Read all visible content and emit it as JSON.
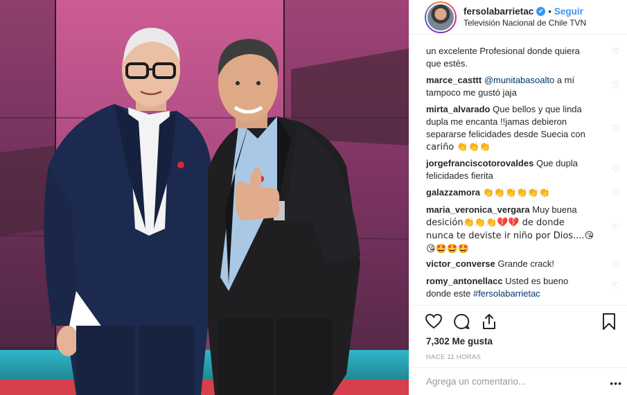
{
  "header": {
    "username": "fersolabarrietac",
    "verified_mark": "✔",
    "separator": "•",
    "follow_label": "Seguir",
    "location": "Televisión Nacional de Chile TVN"
  },
  "comments": [
    {
      "user": "",
      "text": "un excelente Profesional donde quiera",
      "text2": "que estés."
    },
    {
      "user": "marce_casttt",
      "mention": "@munitabasoalto",
      "text": "a mí",
      "text2": "tampoco me gustó jaja"
    },
    {
      "user": "mirta_alvarado",
      "text": "Que bellos y que linda",
      "text2": "dupla me encanta !!jamas debieron",
      "text3": "separarse felicidades desde Suecia con",
      "text4": "cariño 👏👏👏"
    },
    {
      "user": "jorgefranciscotorovaldes",
      "text": "Que dupla",
      "text2": "felicidades fierita"
    },
    {
      "user": "galazzamora",
      "text": "👏👏👏👏👏👏"
    },
    {
      "user": "maria_veronica_vergara",
      "text": "Muy buena",
      "text2": "desición👏👏👏💔💔 de donde",
      "text3": "nunca te deviste ir niño por Dios....😘",
      "text4": "😘🤩🤩🤩"
    },
    {
      "user": "victor_converse",
      "text": "Grande crack!"
    },
    {
      "user": "romy_antonellacc",
      "text": "Usted es bueno",
      "text2": "donde este",
      "mention2": "#fersolabarrietac"
    }
  ],
  "actions": {
    "like_icon": "heart-outline-icon",
    "comment_icon": "comment-bubble-icon",
    "share_icon": "share-icon",
    "save_icon": "bookmark-icon"
  },
  "likes_text": "7,302 Me gusta",
  "timestamp": "HACE 11 HORAS",
  "comment_input": {
    "placeholder": "Agrega un comentario..."
  },
  "more_label": "•••",
  "colors": {
    "accent": "#3897f0",
    "text": "#262626",
    "muted": "#999999",
    "border": "#efefef"
  }
}
